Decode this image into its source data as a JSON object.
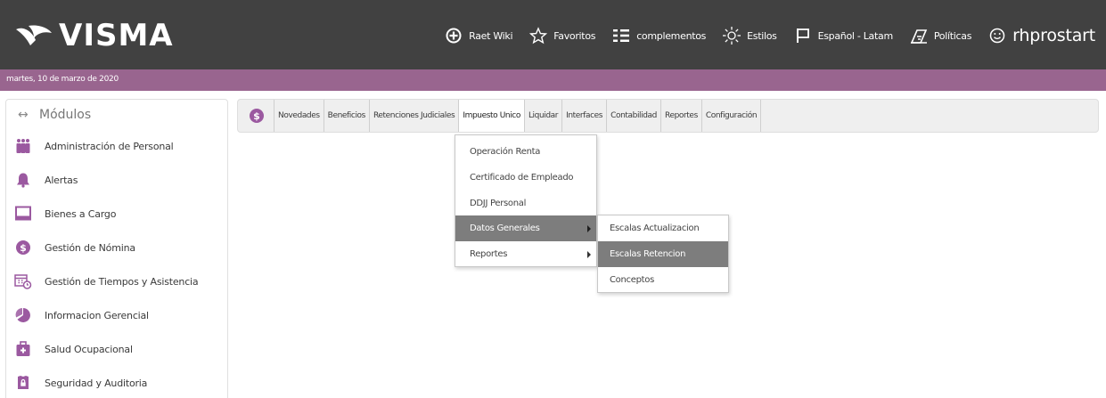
{
  "header": {
    "brand": "VISMA",
    "nav": [
      {
        "label": "Raet Wiki",
        "icon": "plus-circle-icon"
      },
      {
        "label": "Favoritos",
        "icon": "star-icon"
      },
      {
        "label": "complementos",
        "icon": "grid-icon"
      },
      {
        "label": "Estilos",
        "icon": "sun-icon"
      },
      {
        "label": "Español - Latam",
        "icon": "flag-icon"
      },
      {
        "label": "Políticas",
        "icon": "policy-icon"
      },
      {
        "label": "rhprostart",
        "icon": "smiley-icon"
      }
    ]
  },
  "datebar": {
    "date": "martes, 10 de marzo de 2020"
  },
  "sidebar": {
    "title": "Módulos",
    "items": [
      {
        "label": "Administración de Personal",
        "icon": "people-icon",
        "color": "#9b59a0"
      },
      {
        "label": "Alertas",
        "icon": "bell-icon",
        "color": "#9b59a0"
      },
      {
        "label": "Bienes a Cargo",
        "icon": "monitor-icon",
        "color": "#9b59a0"
      },
      {
        "label": "Gestión de Nómina",
        "icon": "money-icon",
        "color": "#9b59a0"
      },
      {
        "label": "Gestión de Tiempos y Asistencia",
        "icon": "calendar-clock-icon",
        "color": "#9b59a0"
      },
      {
        "label": "Informacion Gerencial",
        "icon": "pie-chart-icon",
        "color": "#9b59a0"
      },
      {
        "label": "Salud Ocupacional",
        "icon": "first-aid-icon",
        "color": "#9b59a0"
      },
      {
        "label": "Seguridad y Auditoria",
        "icon": "lock-icon",
        "color": "#9b59a0"
      }
    ]
  },
  "toolbar": {
    "tabs": [
      {
        "label": "Novedades",
        "active": false
      },
      {
        "label": "Beneficios",
        "active": false
      },
      {
        "label": "Retenciones Judiciales",
        "active": false
      },
      {
        "label": "Impuesto Unico",
        "active": true
      },
      {
        "label": "Liquidar",
        "active": false
      },
      {
        "label": "Interfaces",
        "active": false
      },
      {
        "label": "Contabilidad",
        "active": false
      },
      {
        "label": "Reportes",
        "active": false
      },
      {
        "label": "Configuración",
        "active": false
      }
    ]
  },
  "menu": {
    "items": [
      {
        "label": "Operación Renta",
        "submenu": false,
        "highlighted": false
      },
      {
        "label": "Certificado de Empleado",
        "submenu": false,
        "highlighted": false
      },
      {
        "label": "DDJJ Personal",
        "submenu": false,
        "highlighted": false
      },
      {
        "label": "Datos Generales",
        "submenu": true,
        "highlighted": true
      },
      {
        "label": "Reportes",
        "submenu": true,
        "highlighted": false
      }
    ],
    "submenu": [
      {
        "label": "Escalas Actualizacion",
        "highlighted": false
      },
      {
        "label": "Escalas Retencion",
        "highlighted": true
      },
      {
        "label": "Conceptos",
        "highlighted": false
      }
    ]
  },
  "colors": {
    "header_bg": "#414141",
    "datebar_bg": "#99658f",
    "accent_purple": "#9b59a0",
    "menu_highlight": "#7d7d7d"
  }
}
